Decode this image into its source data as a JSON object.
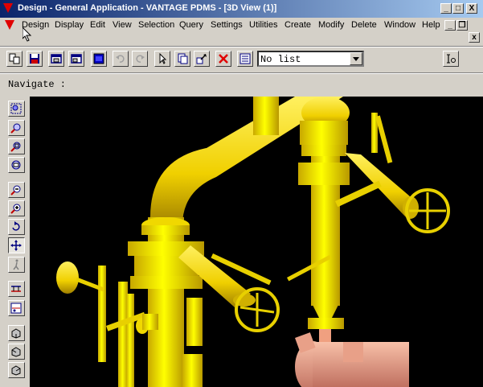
{
  "window": {
    "title": "Design - General Application - VANTAGE PDMS - [3D View (1)]",
    "minimize_label": "_",
    "maximize_label": "□",
    "close_label": "X"
  },
  "menu": {
    "items": [
      "Design",
      "Display",
      "Edit",
      "View",
      "Selection",
      "Query",
      "Settings",
      "Utilities",
      "Create",
      "Modify",
      "Delete",
      "Window",
      "Help"
    ],
    "mdi_minimize_label": "_",
    "mdi_restore_label": "❐",
    "mdi_close_label": "x"
  },
  "toolbar": {
    "list_select": {
      "value": "No list"
    },
    "icons": [
      "new-element-icon",
      "save-icon",
      "open-window-icon",
      "window-icon",
      "blue-window-icon",
      "undo-icon",
      "redo-icon",
      "pointer-icon",
      "copy-icon",
      "move-icon",
      "delete-icon",
      "list-icon"
    ],
    "right_icon": "input-icon"
  },
  "navigate": {
    "label": "Navigate :"
  },
  "sidebar": {
    "icons": [
      "zoom-window-icon",
      "zoom-icon",
      "zoom-limits-icon",
      "view-settings-icon",
      "zoom-out-icon",
      "zoom-in-icon",
      "rotate-icon",
      "pan-icon",
      "walk-icon",
      "limits-icon",
      "clip-edit-icon",
      "iso-view-1-icon",
      "iso-view-2-icon",
      "iso-view-3-icon"
    ]
  },
  "colors": {
    "pipe_yellow": "#ffff00",
    "pipe_shade": "#c8a800",
    "equipment_salmon": "#e8a088",
    "background": "#000000",
    "titlebar_start": "#0a246a",
    "titlebar_end": "#a6caf0"
  }
}
